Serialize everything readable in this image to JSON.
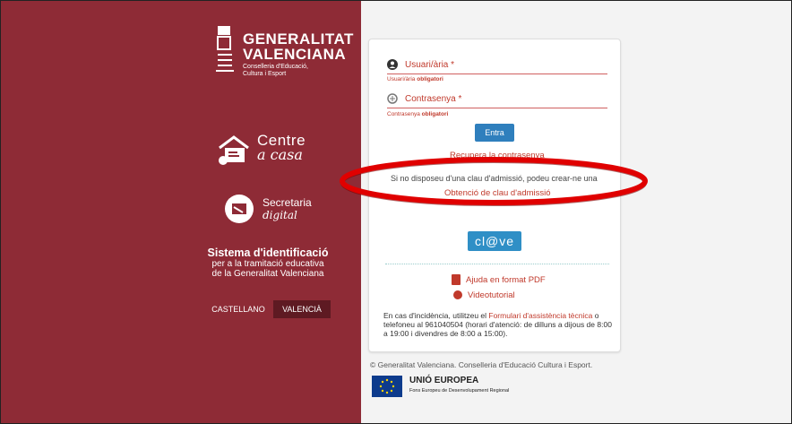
{
  "brand": {
    "name_line1": "GENERALITAT",
    "name_line2": "VALENCIANA",
    "dept_line1": "Conselleria d'Educació,",
    "dept_line2": "Cultura i Esport"
  },
  "sidebar": {
    "centre": {
      "line1": "Centre",
      "line2": "a casa"
    },
    "secretaria": {
      "line1": "Secretaria",
      "line2": "digital"
    },
    "system": {
      "title": "Sistema d'identificació",
      "line1": "per a la tramitació educativa",
      "line2": "de la Generalitat Valenciana"
    },
    "languages": [
      {
        "label": "CASTELLANO"
      },
      {
        "label": "VALENCIÀ"
      }
    ]
  },
  "login": {
    "user": {
      "placeholder": "Usuari/ària *",
      "error_prefix": "Usuari/ària",
      "error_suffix": "obligatori"
    },
    "password": {
      "placeholder": "Contrasenya *",
      "error_prefix": "Contrasenya",
      "error_suffix": "obligatori"
    },
    "submit_label": "Entra",
    "recover_label": "Recupera la contrasenya",
    "no_key_text": "Si no disposeu d'una clau d'admissió, podeu crear-ne una",
    "obtain_key_label": "Obtenció de clau d'admissió",
    "clave_label": "cl@ve",
    "help_pdf_label": "Ajuda en format PDF",
    "video_label": "Videotutorial",
    "incidence": {
      "before": "En cas d'incidència, utilitzeu el ",
      "link": "Formulari d'assistència tècnica",
      "after": " o telefoneu al 961040504 (horari d'atenció: de dilluns a dijous de 8:00 a 19:00 i divendres de 8:00 a 15:00)."
    }
  },
  "footer": {
    "copyright": "© Generalitat Valenciana. Conselleria d'Educació Cultura i Esport.",
    "eu_title": "UNIÓ EUROPEA",
    "eu_subtitle": "Fons Europeu de Desenvolupament Regional"
  },
  "colors": {
    "sidebar": "#8e2b36",
    "accent": "#c0392b",
    "button": "#2f7fbd",
    "highlight": "#e00000"
  }
}
